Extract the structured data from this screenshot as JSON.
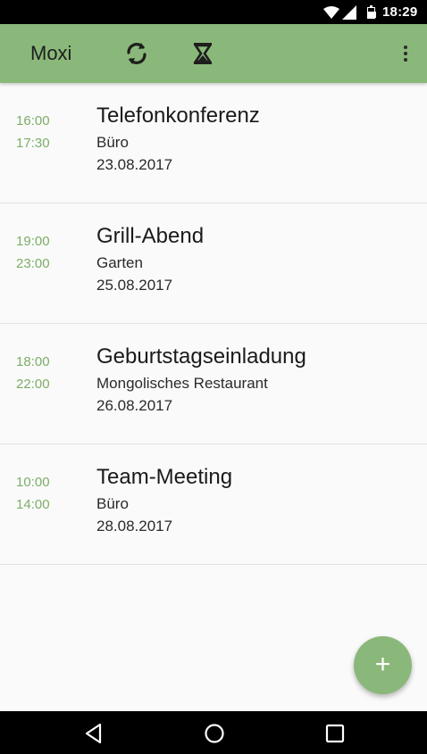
{
  "status_bar": {
    "time": "18:29",
    "icons": [
      "wifi-icon",
      "signal-icon",
      "battery-icon"
    ]
  },
  "toolbar": {
    "title": "Moxi",
    "actions": [
      "refresh-icon",
      "hourglass-icon",
      "more-vert-icon"
    ]
  },
  "events": [
    {
      "start": "16:00",
      "end": "17:30",
      "name": "Telefonkonferenz",
      "place": "Büro",
      "date": "23.08.2017"
    },
    {
      "start": "19:00",
      "end": "23:00",
      "name": "Grill-Abend",
      "place": "Garten",
      "date": "25.08.2017"
    },
    {
      "start": "18:00",
      "end": "22:00",
      "name": "Geburtstagseinladung",
      "place": "Mongolisches Restaurant",
      "date": "26.08.2017"
    },
    {
      "start": "10:00",
      "end": "14:00",
      "name": "Team-Meeting",
      "place": "Büro",
      "date": "28.08.2017"
    }
  ],
  "fab": {
    "label": "+",
    "icon": "add-icon"
  },
  "nav_bar": {
    "buttons": [
      "back-icon",
      "home-icon",
      "recents-icon"
    ]
  },
  "colors": {
    "accent": "#8ab87a",
    "time_text": "#7cae68",
    "background": "#fafafa"
  }
}
